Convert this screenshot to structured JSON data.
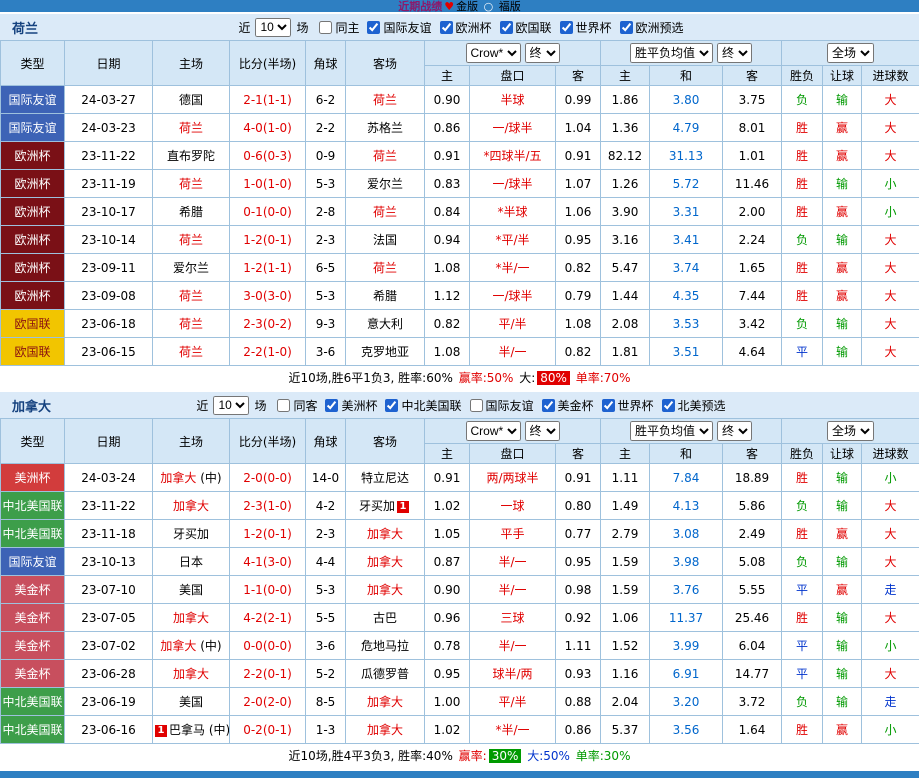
{
  "topbar": {
    "title": "近期战绩",
    "heart_icon": "♥",
    "gold_label": "金版",
    "circle_icon": "○",
    "fu_label": "福版"
  },
  "league_styles": {
    "国际友谊": {
      "bg": "#3D63B6",
      "fg": "#ffffff"
    },
    "欧洲杯": {
      "bg": "#7A1016",
      "fg": "#ffffff"
    },
    "欧国联": {
      "bg": "#F2C500",
      "fg": "#8a1111"
    },
    "美洲杯": {
      "bg": "#D23C3C",
      "fg": "#ffffff"
    },
    "中北美国联": {
      "bg": "#3D9E4A",
      "fg": "#ffffff"
    },
    "美金杯": {
      "bg": "#C84F5E",
      "fg": "#ffffff"
    }
  },
  "outcome_colors": {
    "胜": "#E00000",
    "负": "#009900",
    "平": "#0033CC",
    "赢": "#E00000",
    "输": "#009900",
    "走": "#0033CC",
    "大": "#E00000",
    "小": "#009900"
  },
  "sections": [
    {
      "team": "荷兰",
      "near_label": "近",
      "match_count": "10",
      "games_label": "场",
      "filters": [
        {
          "label": "同主",
          "checked": false
        },
        {
          "label": "国际友谊",
          "checked": true
        },
        {
          "label": "欧洲杯",
          "checked": true
        },
        {
          "label": "欧国联",
          "checked": true
        },
        {
          "label": "世界杯",
          "checked": true
        },
        {
          "label": "欧洲预选",
          "checked": true
        }
      ],
      "selects": {
        "odds_source": "Crow*",
        "odds_final": "终",
        "avg": "胜平负均值",
        "avg_final": "终",
        "scope": "全场"
      },
      "headers": {
        "type": "类型",
        "date": "日期",
        "home": "主场",
        "score": "比分(半场)",
        "corner": "角球",
        "away": "客场",
        "odds_home": "主",
        "handicap": "盘口",
        "odds_away": "客",
        "avg_home": "主",
        "avg_draw": "和",
        "avg_away": "客",
        "result": "胜负",
        "let_ball": "让球",
        "goals": "进球数"
      },
      "rows": [
        {
          "league": "国际友谊",
          "date": "24-03-27",
          "home": {
            "name": "德国"
          },
          "score": "2-1(1-1)",
          "corner": "6-2",
          "away": {
            "name": "荷兰",
            "focal": true
          },
          "odds": [
            "0.90",
            "半球",
            "0.99"
          ],
          "avg": [
            "1.86",
            "3.80",
            "3.75"
          ],
          "outcome": [
            "负",
            "输",
            "大"
          ]
        },
        {
          "league": "国际友谊",
          "date": "24-03-23",
          "home": {
            "name": "荷兰",
            "focal": true
          },
          "score": "4-0(1-0)",
          "corner": "2-2",
          "away": {
            "name": "苏格兰"
          },
          "odds": [
            "0.86",
            "一/球半",
            "1.04"
          ],
          "avg": [
            "1.36",
            "4.79",
            "8.01"
          ],
          "outcome": [
            "胜",
            "赢",
            "大"
          ]
        },
        {
          "league": "欧洲杯",
          "date": "23-11-22",
          "home": {
            "name": "直布罗陀"
          },
          "score": "0-6(0-3)",
          "corner": "0-9",
          "away": {
            "name": "荷兰",
            "focal": true
          },
          "odds": [
            "0.91",
            "*四球半/五",
            "0.91"
          ],
          "avg": [
            "82.12",
            "31.13",
            "1.01"
          ],
          "outcome": [
            "胜",
            "赢",
            "大"
          ]
        },
        {
          "league": "欧洲杯",
          "date": "23-11-19",
          "home": {
            "name": "荷兰",
            "focal": true
          },
          "score": "1-0(1-0)",
          "corner": "5-3",
          "away": {
            "name": "爱尔兰"
          },
          "odds": [
            "0.83",
            "一/球半",
            "1.07"
          ],
          "avg": [
            "1.26",
            "5.72",
            "11.46"
          ],
          "outcome": [
            "胜",
            "输",
            "小"
          ]
        },
        {
          "league": "欧洲杯",
          "date": "23-10-17",
          "home": {
            "name": "希腊"
          },
          "score": "0-1(0-0)",
          "corner": "2-8",
          "away": {
            "name": "荷兰",
            "focal": true
          },
          "odds": [
            "0.84",
            "*半球",
            "1.06"
          ],
          "avg": [
            "3.90",
            "3.31",
            "2.00"
          ],
          "outcome": [
            "胜",
            "赢",
            "小"
          ]
        },
        {
          "league": "欧洲杯",
          "date": "23-10-14",
          "home": {
            "name": "荷兰",
            "focal": true
          },
          "score": "1-2(0-1)",
          "corner": "2-3",
          "away": {
            "name": "法国"
          },
          "odds": [
            "0.94",
            "*平/半",
            "0.95"
          ],
          "avg": [
            "3.16",
            "3.41",
            "2.24"
          ],
          "outcome": [
            "负",
            "输",
            "大"
          ]
        },
        {
          "league": "欧洲杯",
          "date": "23-09-11",
          "home": {
            "name": "爱尔兰"
          },
          "score": "1-2(1-1)",
          "corner": "6-5",
          "away": {
            "name": "荷兰",
            "focal": true
          },
          "odds": [
            "1.08",
            "*半/一",
            "0.82"
          ],
          "avg": [
            "5.47",
            "3.74",
            "1.65"
          ],
          "outcome": [
            "胜",
            "赢",
            "大"
          ]
        },
        {
          "league": "欧洲杯",
          "date": "23-09-08",
          "home": {
            "name": "荷兰",
            "focal": true
          },
          "score": "3-0(3-0)",
          "corner": "5-3",
          "away": {
            "name": "希腊"
          },
          "odds": [
            "1.12",
            "一/球半",
            "0.79"
          ],
          "avg": [
            "1.44",
            "4.35",
            "7.44"
          ],
          "outcome": [
            "胜",
            "赢",
            "大"
          ]
        },
        {
          "league": "欧国联",
          "date": "23-06-18",
          "home": {
            "name": "荷兰",
            "focal": true
          },
          "score": "2-3(0-2)",
          "corner": "9-3",
          "away": {
            "name": "意大利"
          },
          "odds": [
            "0.82",
            "平/半",
            "1.08"
          ],
          "avg": [
            "2.08",
            "3.53",
            "3.42"
          ],
          "outcome": [
            "负",
            "输",
            "大"
          ]
        },
        {
          "league": "欧国联",
          "date": "23-06-15",
          "home": {
            "name": "荷兰",
            "focal": true
          },
          "score": "2-2(1-0)",
          "corner": "3-6",
          "away": {
            "name": "克罗地亚"
          },
          "odds": [
            "1.08",
            "半/一",
            "0.82"
          ],
          "avg": [
            "1.81",
            "3.51",
            "4.64"
          ],
          "outcome": [
            "平",
            "输",
            "大"
          ]
        }
      ],
      "summary": [
        {
          "text": "近10场,胜6平1负3, 胜率:60% ",
          "color": "#000000"
        },
        {
          "text": "赢率:50% ",
          "color": "#E00000"
        },
        {
          "text": "大:",
          "color": "#000000"
        },
        {
          "text": "80%",
          "color": "#ffffff",
          "bg": "#E00000"
        },
        {
          "text": " 单率:70%",
          "color": "#E00000"
        }
      ]
    },
    {
      "team": "加拿大",
      "near_label": "近",
      "match_count": "10",
      "games_label": "场",
      "filters": [
        {
          "label": "同客",
          "checked": false
        },
        {
          "label": "美洲杯",
          "checked": true
        },
        {
          "label": "中北美国联",
          "checked": true
        },
        {
          "label": "国际友谊",
          "checked": false
        },
        {
          "label": "美金杯",
          "checked": true
        },
        {
          "label": "世界杯",
          "checked": true
        },
        {
          "label": "北美预选",
          "checked": true
        }
      ],
      "selects": {
        "odds_source": "Crow*",
        "odds_final": "终",
        "avg": "胜平负均值",
        "avg_final": "终",
        "scope": "全场"
      },
      "headers": {
        "type": "类型",
        "date": "日期",
        "home": "主场",
        "score": "比分(半场)",
        "corner": "角球",
        "away": "客场",
        "odds_home": "主",
        "handicap": "盘口",
        "odds_away": "客",
        "avg_home": "主",
        "avg_draw": "和",
        "avg_away": "客",
        "result": "胜负",
        "let_ball": "让球",
        "goals": "进球数"
      },
      "rows": [
        {
          "league": "美洲杯",
          "date": "24-03-24",
          "home": {
            "name": "加拿大",
            "focal": true,
            "neutral": true
          },
          "score": "2-0(0-0)",
          "corner": "14-0",
          "away": {
            "name": "特立尼达"
          },
          "odds": [
            "0.91",
            "两/两球半",
            "0.91"
          ],
          "avg": [
            "1.11",
            "7.84",
            "18.89"
          ],
          "outcome": [
            "胜",
            "输",
            "小"
          ]
        },
        {
          "league": "中北美国联",
          "date": "23-11-22",
          "home": {
            "name": "加拿大",
            "focal": true
          },
          "score": "2-3(1-0)",
          "corner": "4-2",
          "away": {
            "name": "牙买加",
            "mark": "1",
            "mark_pos": "after"
          },
          "odds": [
            "1.02",
            "一球",
            "0.80"
          ],
          "avg": [
            "1.49",
            "4.13",
            "5.86"
          ],
          "outcome": [
            "负",
            "输",
            "大"
          ]
        },
        {
          "league": "中北美国联",
          "date": "23-11-18",
          "home": {
            "name": "牙买加"
          },
          "score": "1-2(0-1)",
          "corner": "2-3",
          "away": {
            "name": "加拿大",
            "focal": true
          },
          "odds": [
            "1.05",
            "平手",
            "0.77"
          ],
          "avg": [
            "2.79",
            "3.08",
            "2.49"
          ],
          "outcome": [
            "胜",
            "赢",
            "大"
          ]
        },
        {
          "league": "国际友谊",
          "date": "23-10-13",
          "home": {
            "name": "日本"
          },
          "score": "4-1(3-0)",
          "corner": "4-4",
          "away": {
            "name": "加拿大",
            "focal": true
          },
          "odds": [
            "0.87",
            "半/一",
            "0.95"
          ],
          "avg": [
            "1.59",
            "3.98",
            "5.08"
          ],
          "outcome": [
            "负",
            "输",
            "大"
          ]
        },
        {
          "league": "美金杯",
          "date": "23-07-10",
          "home": {
            "name": "美国"
          },
          "score": "1-1(0-0)",
          "corner": "5-3",
          "away": {
            "name": "加拿大",
            "focal": true
          },
          "odds": [
            "0.90",
            "半/一",
            "0.98"
          ],
          "avg": [
            "1.59",
            "3.76",
            "5.55"
          ],
          "outcome": [
            "平",
            "赢",
            "走"
          ]
        },
        {
          "league": "美金杯",
          "date": "23-07-05",
          "home": {
            "name": "加拿大",
            "focal": true
          },
          "score": "4-2(2-1)",
          "corner": "5-5",
          "away": {
            "name": "古巴"
          },
          "odds": [
            "0.96",
            "三球",
            "0.92"
          ],
          "avg": [
            "1.06",
            "11.37",
            "25.46"
          ],
          "outcome": [
            "胜",
            "输",
            "大"
          ]
        },
        {
          "league": "美金杯",
          "date": "23-07-02",
          "home": {
            "name": "加拿大",
            "focal": true,
            "neutral": true
          },
          "score": "0-0(0-0)",
          "corner": "3-6",
          "away": {
            "name": "危地马拉"
          },
          "odds": [
            "0.78",
            "半/一",
            "1.11"
          ],
          "avg": [
            "1.52",
            "3.99",
            "6.04"
          ],
          "outcome": [
            "平",
            "输",
            "小"
          ]
        },
        {
          "league": "美金杯",
          "date": "23-06-28",
          "home": {
            "name": "加拿大",
            "focal": true
          },
          "score": "2-2(0-1)",
          "corner": "5-2",
          "away": {
            "name": "瓜德罗普"
          },
          "odds": [
            "0.95",
            "球半/两",
            "0.93"
          ],
          "avg": [
            "1.16",
            "6.91",
            "14.77"
          ],
          "outcome": [
            "平",
            "输",
            "大"
          ]
        },
        {
          "league": "中北美国联",
          "date": "23-06-19",
          "home": {
            "name": "美国"
          },
          "score": "2-0(2-0)",
          "corner": "8-5",
          "away": {
            "name": "加拿大",
            "focal": true
          },
          "odds": [
            "1.00",
            "平/半",
            "0.88"
          ],
          "avg": [
            "2.04",
            "3.20",
            "3.72"
          ],
          "outcome": [
            "负",
            "输",
            "走"
          ]
        },
        {
          "league": "中北美国联",
          "date": "23-06-16",
          "home": {
            "name": "巴拿马",
            "neutral": true,
            "mark": "1",
            "mark_pos": "before"
          },
          "score": "0-2(0-1)",
          "corner": "1-3",
          "away": {
            "name": "加拿大",
            "focal": true
          },
          "odds": [
            "1.02",
            "*半/一",
            "0.86"
          ],
          "avg": [
            "5.37",
            "3.56",
            "1.64"
          ],
          "outcome": [
            "胜",
            "赢",
            "小"
          ]
        }
      ],
      "summary": [
        {
          "text": "近10场,胜4平3负3, 胜率:40% ",
          "color": "#000000"
        },
        {
          "text": "赢率:",
          "color": "#E00000"
        },
        {
          "text": "30%",
          "color": "#ffffff",
          "bg": "#009A00"
        },
        {
          "text": " 大:50% ",
          "color": "#0033CC"
        },
        {
          "text": "单率:30%",
          "color": "#009A00"
        }
      ]
    }
  ]
}
